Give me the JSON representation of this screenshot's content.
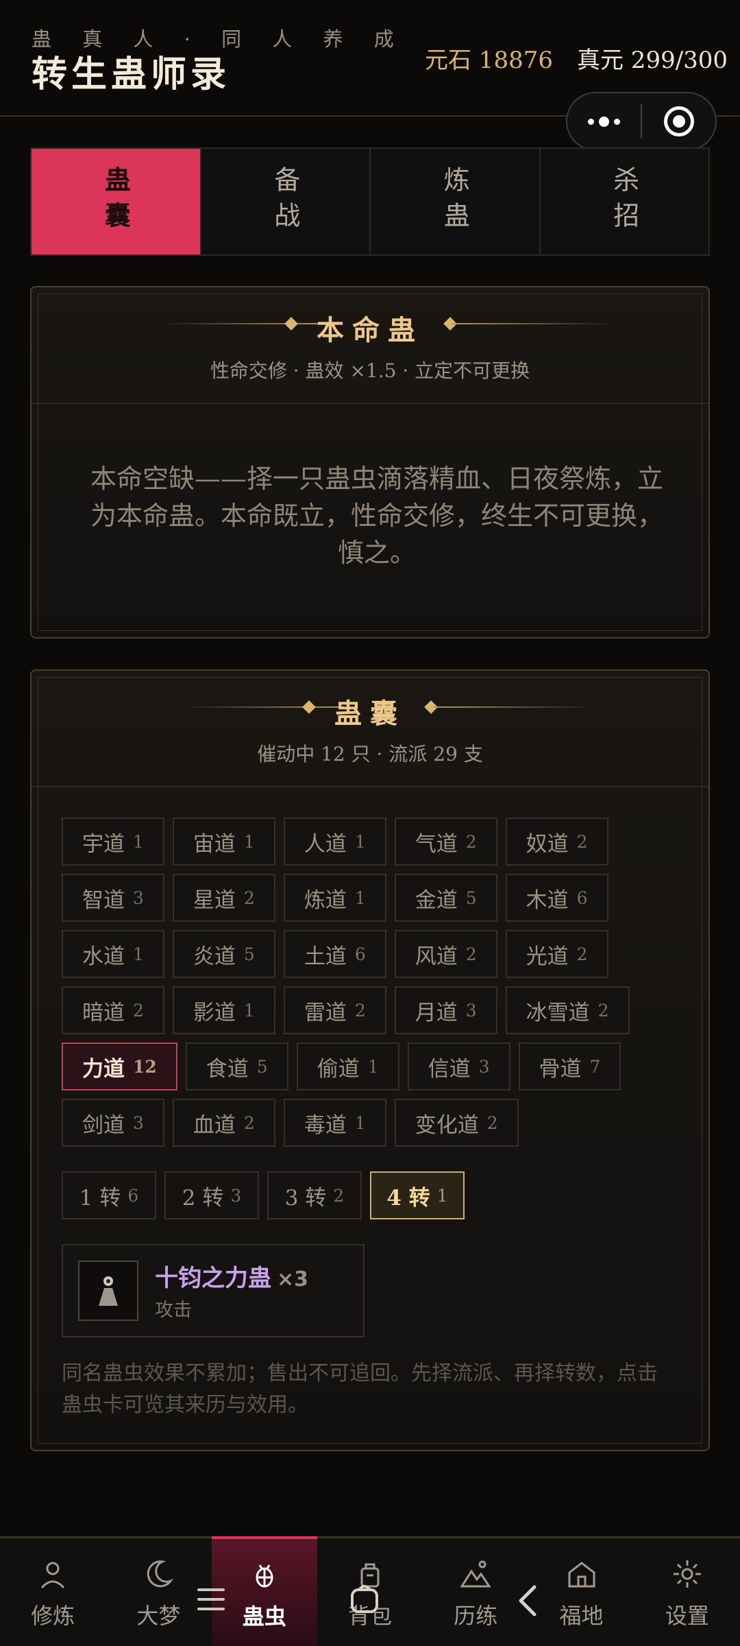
{
  "header": {
    "subtitle": "蛊 真 人 · 同 人 养 成",
    "title": "转生蛊师录",
    "stone": "元石 18876",
    "zhenyuan": "真元 299/300"
  },
  "capsule": {
    "more_icon": "more-dots-icon",
    "close_icon": "target-circle-icon"
  },
  "tabs": [
    {
      "label": "蛊囊",
      "active": true
    },
    {
      "label": "备战",
      "active": false
    },
    {
      "label": "炼蛊",
      "active": false
    },
    {
      "label": "杀招",
      "active": false
    }
  ],
  "life_card": {
    "title": "本命蛊",
    "subtitle": "性命交修 · 蛊效 ×1.5 · 立定不可更换",
    "text": "本命空缺——择一只蛊虫滴落精血、日夜祭炼，立为本命蛊。本命既立，性命交修，终生不可更换，慎之。"
  },
  "bag_card": {
    "title": "蛊囊",
    "subtitle": "催动中 12 只 · 流派 29 支",
    "chip_rows": [
      [
        {
          "name": "宇道",
          "n": "1"
        },
        {
          "name": "宙道",
          "n": "1"
        },
        {
          "name": "人道",
          "n": "1"
        },
        {
          "name": "气道",
          "n": "2"
        },
        {
          "name": "奴道",
          "n": "2"
        }
      ],
      [
        {
          "name": "智道",
          "n": "3"
        },
        {
          "name": "星道",
          "n": "2"
        },
        {
          "name": "炼道",
          "n": "1"
        },
        {
          "name": "金道",
          "n": "5"
        },
        {
          "name": "木道",
          "n": "6"
        }
      ],
      [
        {
          "name": "水道",
          "n": "1"
        },
        {
          "name": "炎道",
          "n": "5"
        },
        {
          "name": "土道",
          "n": "6"
        },
        {
          "name": "风道",
          "n": "2"
        },
        {
          "name": "光道",
          "n": "2"
        }
      ],
      [
        {
          "name": "暗道",
          "n": "2"
        },
        {
          "name": "影道",
          "n": "1"
        },
        {
          "name": "雷道",
          "n": "2"
        },
        {
          "name": "月道",
          "n": "3"
        },
        {
          "name": "冰雪道",
          "n": "2"
        }
      ],
      [
        {
          "name": "力道",
          "n": "12",
          "active": true
        },
        {
          "name": "食道",
          "n": "5"
        },
        {
          "name": "偷道",
          "n": "1"
        },
        {
          "name": "信道",
          "n": "3"
        },
        {
          "name": "骨道",
          "n": "7"
        }
      ],
      [
        {
          "name": "剑道",
          "n": "3"
        },
        {
          "name": "血道",
          "n": "2"
        },
        {
          "name": "毒道",
          "n": "1"
        },
        {
          "name": "变化道",
          "n": "2"
        }
      ]
    ],
    "turns": [
      {
        "label": "1 转",
        "n": "6"
      },
      {
        "label": "2 转",
        "n": "3"
      },
      {
        "label": "3 转",
        "n": "2"
      },
      {
        "label": "4 转",
        "n": "1",
        "active": true
      }
    ],
    "gu": {
      "name": "十钧之力蛊",
      "count": "×3",
      "type": "攻击",
      "icon": "gu-figure-icon"
    },
    "note": "同名蛊虫效果不累加；售出不可追回。先择流派、再择转数，点击蛊虫卡可览其来历与效用。"
  },
  "bottom_nav": [
    {
      "label": "修炼",
      "icon": "person-icon"
    },
    {
      "label": "大梦",
      "icon": "moon-icon"
    },
    {
      "label": "蛊虫",
      "icon": "bug-icon",
      "active": true
    },
    {
      "label": "背包",
      "icon": "bag-icon"
    },
    {
      "label": "历练",
      "icon": "mountain-icon"
    },
    {
      "label": "福地",
      "icon": "home-icon"
    },
    {
      "label": "设置",
      "icon": "gear-icon"
    }
  ],
  "colors": {
    "accent": "#db3559",
    "gold": "#d9b46c",
    "purple": "#c9a2ea"
  }
}
